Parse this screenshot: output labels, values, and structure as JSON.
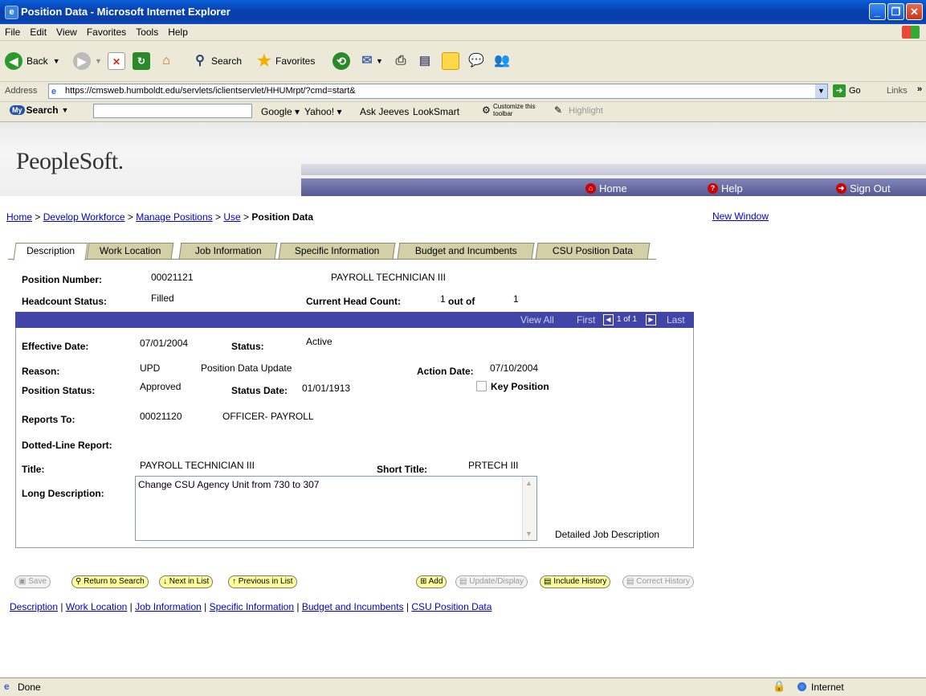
{
  "window": {
    "title": "Position Data - Microsoft Internet Explorer"
  },
  "menu": [
    "File",
    "Edit",
    "View",
    "Favorites",
    "Tools",
    "Help"
  ],
  "toolbar": {
    "back": "Back",
    "search": "Search",
    "favorites": "Favorites"
  },
  "address": {
    "label": "Address",
    "url": "https://cmsweb.humboldt.edu/servlets/iclientservlet/HHUMrpt/?cmd=start&",
    "go": "Go",
    "links": "Links"
  },
  "searchbar": {
    "brand": "Search",
    "google": "Google",
    "yahoo": "Yahoo!",
    "askjeeves": "Ask Jeeves",
    "looksmart": "LookSmart",
    "customize": "Customize this toolbar",
    "highlight": "Highlight"
  },
  "header": {
    "logo": "PeopleSoft.",
    "home": "Home",
    "help": "Help",
    "signout": "Sign Out"
  },
  "breadcrumb": {
    "home": "Home",
    "develop": "Develop Workforce",
    "manage": "Manage Positions",
    "use": "Use",
    "current": "Position Data",
    "sep": ">"
  },
  "new_window": "New Window",
  "tabs": [
    "Description",
    "Work Location",
    "Job Information",
    "Specific Information",
    "Budget and Incumbents",
    "CSU Position Data"
  ],
  "position": {
    "number_label": "Position Number:",
    "number": "00021121",
    "name": "PAYROLL TECHNICIAN III",
    "headcount_label": "Headcount Status:",
    "headcount": "Filled",
    "current_label": "Current Head Count:",
    "current": "1",
    "out_of": "out of",
    "total": "1"
  },
  "grid": {
    "view_all": "View All",
    "first": "First",
    "range": "1 of 1",
    "last": "Last"
  },
  "detail": {
    "eff_label": "Effective Date:",
    "eff": "07/01/2004",
    "status_label": "Status:",
    "status": "Active",
    "reason_label": "Reason:",
    "reason": "UPD",
    "reason_desc": "Position Data Update",
    "action_label": "Action Date:",
    "action": "07/10/2004",
    "pos_status_label": "Position Status:",
    "pos_status": "Approved",
    "status_date_label": "Status Date:",
    "status_date": "01/01/1913",
    "key_position": "Key Position",
    "reports_label": "Reports To:",
    "reports": "00021120",
    "reports_desc": "OFFICER- PAYROLL",
    "dotted_label": "Dotted-Line Report:",
    "title_label": "Title:",
    "title": "PAYROLL TECHNICIAN III",
    "short_label": "Short Title:",
    "short": "PRTECH III",
    "long_label": "Long Description:",
    "long": "Change CSU Agency Unit from 730 to 307",
    "detailed_job": "Detailed Job Description"
  },
  "buttons": {
    "save": "Save",
    "return": "Return to Search",
    "next": "Next in List",
    "previous": "Previous in List",
    "add": "Add",
    "update": "Update/Display",
    "include": "Include History",
    "correct": "Correct History"
  },
  "bottom_links": [
    "Description",
    "Work Location",
    "Job Information",
    "Specific Information",
    "Budget and Incumbents",
    "CSU Position Data"
  ],
  "status": {
    "text": "Done",
    "zone": "Internet"
  }
}
